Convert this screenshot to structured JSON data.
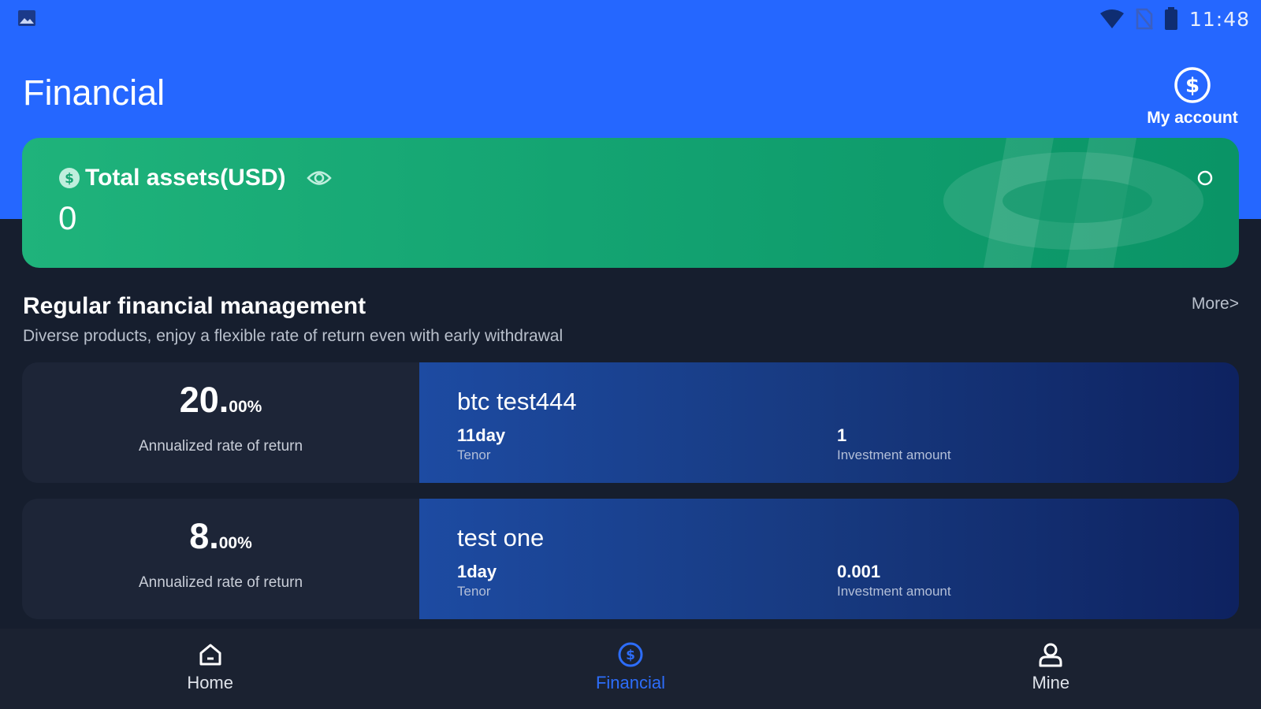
{
  "status_bar": {
    "time": "11:48",
    "icons": [
      "image-icon",
      "wifi-icon",
      "no-sim-icon",
      "battery-icon"
    ]
  },
  "header": {
    "title": "Financial",
    "account_label": "My account",
    "account_icon": "dollar-circle-icon"
  },
  "assets": {
    "label": "Total assets(USD)",
    "value": "0",
    "icons": [
      "dollar-circle-icon",
      "eye-icon",
      "refresh-icon"
    ]
  },
  "section": {
    "title": "Regular financial management",
    "subtitle": "Diverse products, enjoy a flexible rate of return even with early withdrawal",
    "more": "More>"
  },
  "products": [
    {
      "rate_int": "20",
      "rate_dot": ".",
      "rate_dec": "00%",
      "rate_label": "Annualized rate of return",
      "name": "btc test444",
      "tenor_value": "11day",
      "tenor_label": "Tenor",
      "invest_value": "1",
      "invest_label": "Investment amount"
    },
    {
      "rate_int": "8",
      "rate_dot": ".",
      "rate_dec": "00%",
      "rate_label": "Annualized rate of return",
      "name": "test one",
      "tenor_value": "1day",
      "tenor_label": "Tenor",
      "invest_value": "0.001",
      "invest_label": "Investment amount"
    }
  ],
  "nav": {
    "items": [
      {
        "label": "Home",
        "icon": "home-icon",
        "active": false
      },
      {
        "label": "Financial",
        "icon": "dollar-circle-icon",
        "active": true
      },
      {
        "label": "Mine",
        "icon": "user-icon",
        "active": false
      }
    ]
  },
  "colors": {
    "header_blue": "#2567ff",
    "assets_green": "#14a472",
    "background": "#161e2e",
    "active_nav": "#2d6dfa"
  }
}
